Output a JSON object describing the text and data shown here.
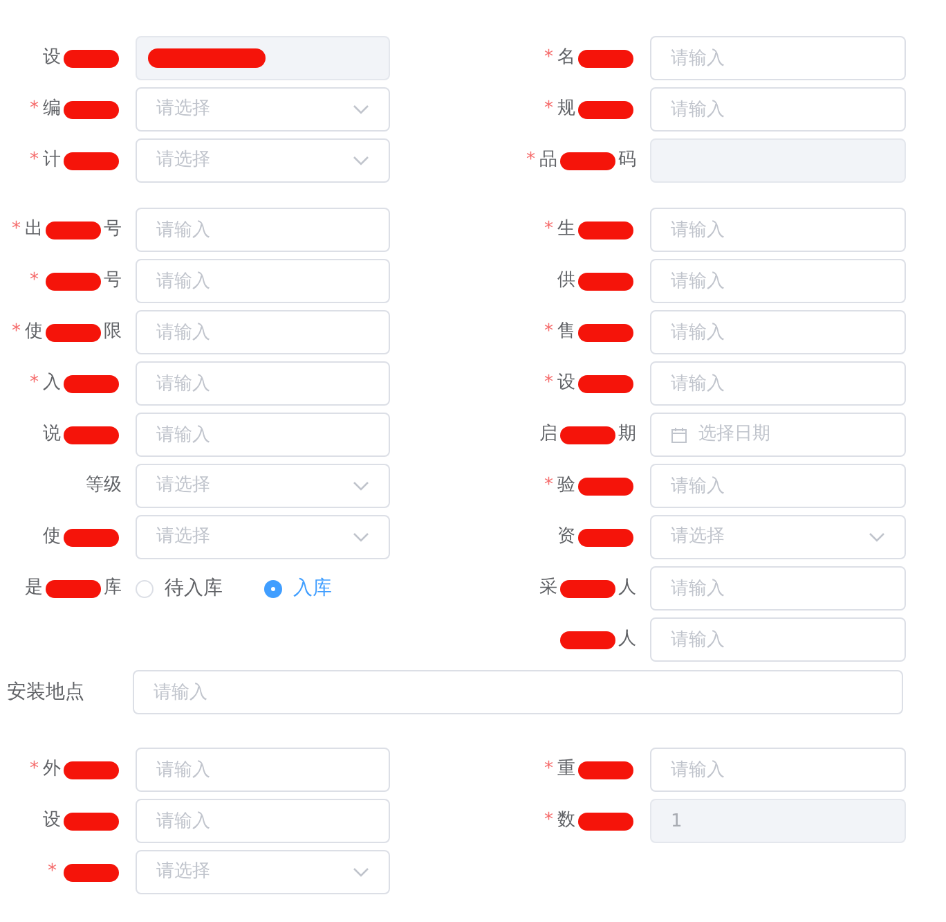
{
  "sections": [
    {
      "left": [
        {
          "label": "设",
          "redacted": true,
          "kind": "input",
          "disabled": true,
          "value_redacted": true
        },
        {
          "required_mark": "*",
          "label": "编",
          "redacted": true,
          "kind": "select",
          "placeholder": "请选择"
        },
        {
          "required_mark": "*",
          "label": "计",
          "redacted": true,
          "kind": "select",
          "placeholder": "请选择"
        }
      ],
      "right": [
        {
          "required_mark": "*",
          "label": "名",
          "redacted": true,
          "kind": "input",
          "placeholder": "请输入"
        },
        {
          "required_mark": "*",
          "label": "规",
          "redacted": true,
          "kind": "input",
          "placeholder": "请输入"
        },
        {
          "required_mark": "*",
          "label": "品",
          "label_end": "码",
          "redacted": true,
          "kind": "input",
          "disabled": true
        }
      ]
    },
    {
      "left": [
        {
          "required_mark": "*",
          "label": "出",
          "label_end": "号",
          "redacted": true,
          "kind": "input",
          "placeholder": "请输入"
        },
        {
          "required_mark": "*",
          "label_end": "号",
          "redacted": true,
          "kind": "input",
          "placeholder": "请输入"
        },
        {
          "required_mark": "*",
          "label": "使",
          "label_end": "限",
          "redacted": true,
          "kind": "input",
          "placeholder": "请输入"
        },
        {
          "required_mark": "*",
          "label": "入",
          "redacted": true,
          "kind": "input",
          "placeholder": "请输入"
        },
        {
          "label": "说",
          "redacted": true,
          "kind": "input",
          "placeholder": "请输入"
        },
        {
          "label": "等级",
          "redacted": false,
          "kind": "select",
          "placeholder": "请选择"
        },
        {
          "label": "使",
          "redacted": true,
          "kind": "select",
          "placeholder": "请选择"
        },
        {
          "label": "是",
          "label_end": "库",
          "redacted": true,
          "kind": "radio",
          "options": [
            {
              "text": "待入库",
              "selected": false
            },
            {
              "text": "入库",
              "selected": true
            }
          ]
        }
      ],
      "right": [
        {
          "required_mark": "*",
          "label": "生",
          "redacted": true,
          "kind": "input",
          "placeholder": "请输入"
        },
        {
          "label": "供",
          "redacted": true,
          "kind": "input",
          "placeholder": "请输入"
        },
        {
          "required_mark": "*",
          "label": "售",
          "redacted": true,
          "kind": "input",
          "placeholder": "请输入"
        },
        {
          "required_mark": "*",
          "label": "设",
          "redacted": true,
          "kind": "input",
          "placeholder": "请输入"
        },
        {
          "label": "启",
          "label_end": "期",
          "redacted": true,
          "kind": "date",
          "placeholder": "选择日期"
        },
        {
          "required_mark": "*",
          "label": "验",
          "redacted": true,
          "kind": "input",
          "placeholder": "请输入"
        },
        {
          "label": "资",
          "redacted": true,
          "kind": "select",
          "placeholder": "请选择"
        },
        {
          "label": "采",
          "label_end": "人",
          "redacted": true,
          "kind": "input",
          "placeholder": "请输入"
        },
        {
          "label_end": "人",
          "redacted": true,
          "kind": "input",
          "placeholder": "请输入"
        }
      ],
      "full": {
        "label": "安装地点",
        "kind": "input",
        "placeholder": "请输入"
      }
    },
    {
      "left": [
        {
          "required_mark": "*",
          "label": "外",
          "redacted": true,
          "kind": "input",
          "placeholder": "请输入"
        },
        {
          "label": "设",
          "redacted": true,
          "kind": "input",
          "placeholder": "请输入"
        },
        {
          "required_mark": "*",
          "redacted": true,
          "kind": "select",
          "placeholder": "请选择"
        }
      ],
      "right": [
        {
          "required_mark": "*",
          "label": "重",
          "redacted": true,
          "kind": "input",
          "placeholder": "请输入"
        },
        {
          "required_mark": "*",
          "label": "数",
          "redacted": true,
          "kind": "input",
          "disabled": true,
          "value": "1"
        }
      ]
    }
  ]
}
